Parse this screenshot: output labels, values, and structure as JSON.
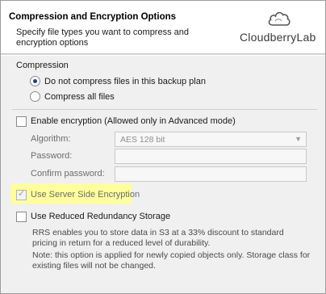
{
  "header": {
    "title": "Compression and Encryption Options",
    "description": "Specify file types you want to compress and encryption options"
  },
  "logo": {
    "text": "CloudberryLab"
  },
  "compression": {
    "section_label": "Compression",
    "options": [
      {
        "label": "Do not compress files in this backup plan",
        "selected": true
      },
      {
        "label": "Compress all files",
        "selected": false
      }
    ]
  },
  "encryption": {
    "enable_label": "Enable encryption (Allowed only in Advanced mode)",
    "enabled": false,
    "algorithm_label": "Algorithm:",
    "algorithm_value": "AES 128 bit",
    "password_label": "Password:",
    "confirm_label": "Confirm password:"
  },
  "sse": {
    "label": "Use Server Side Encryption",
    "checked": true,
    "highlight_color": "#fefe9c"
  },
  "rrs": {
    "label": "Use Reduced Redundancy Storage",
    "checked": false,
    "info1": "RRS enables you to store data in S3 at a 33% discount to standard pricing in return for a reduced level of durability.",
    "info2": "Note: this option is applied for newly copied objects only. Storage class for existing files will not be changed."
  }
}
